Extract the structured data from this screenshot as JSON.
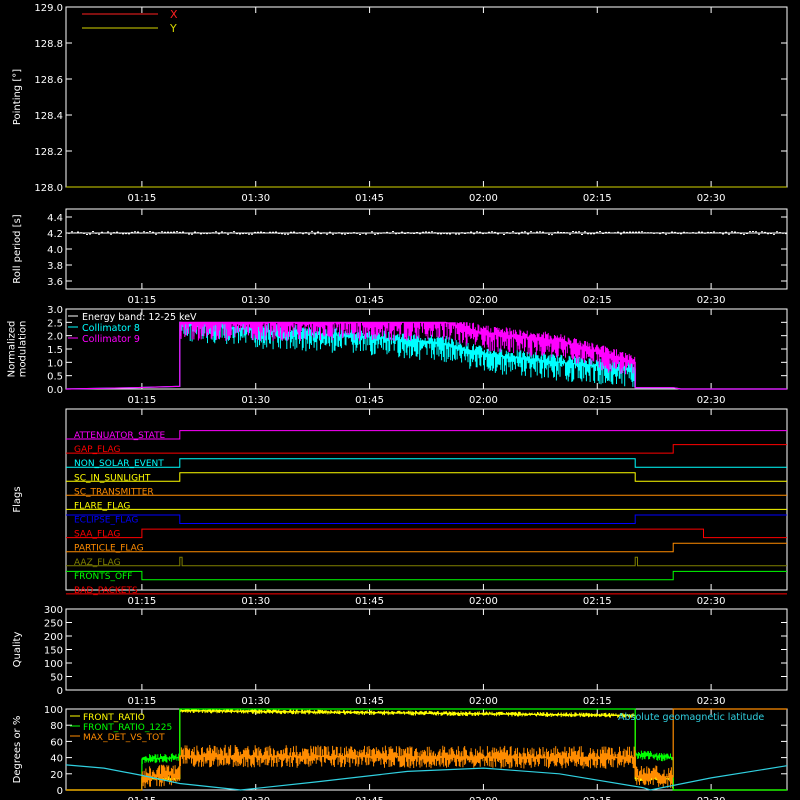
{
  "time_axis": {
    "start": "01:05",
    "end": "02:40",
    "ticks": [
      "01:15",
      "01:30",
      "01:45",
      "02:00",
      "02:15",
      "02:30"
    ]
  },
  "colors": {
    "axes": "#ffffff",
    "x": "#ff2020",
    "y": "#d4d400",
    "white": "#ffffff",
    "cyan": "#00ffff",
    "magenta": "#ff00ff",
    "orange": "#ff8c00",
    "green": "#00ff00",
    "yellow": "#ffff00",
    "blue": "#0000ff",
    "olive": "#808000",
    "red": "#ff0000",
    "geomag": "#30d0e0"
  },
  "chart_data": [
    {
      "id": "pointing",
      "type": "line",
      "ylabel": "Pointing [°]",
      "ylim": [
        128.0,
        129.0
      ],
      "yticks": [
        "128.0",
        "128.2",
        "128.4",
        "128.6",
        "128.8",
        "129.0"
      ],
      "legend": [
        "X",
        "Y"
      ],
      "legend_placement": "top-left",
      "series": [
        {
          "name": "X",
          "color_key": "x",
          "points": [
            [
              "01:05",
              128.0
            ],
            [
              "02:40",
              128.0
            ]
          ]
        },
        {
          "name": "Y",
          "color_key": "y",
          "points": [
            [
              "01:05",
              128.0
            ],
            [
              "02:40",
              128.0
            ]
          ]
        }
      ]
    },
    {
      "id": "roll",
      "type": "line",
      "ylabel": "Roll period [s]",
      "ylim": [
        3.5,
        4.5
      ],
      "yticks": [
        "3.6",
        "3.8",
        "4.0",
        "4.2",
        "4.4"
      ],
      "series": [
        {
          "color_key": "white",
          "points": [
            [
              "01:05",
              4.2
            ],
            [
              "02:40",
              4.2
            ]
          ]
        }
      ]
    },
    {
      "id": "modulation",
      "type": "line",
      "ylabel": [
        "Normalized",
        "modulation"
      ],
      "ylim": [
        0.0,
        3.0
      ],
      "yticks": [
        "0.0",
        "0.5",
        "1.0",
        "1.5",
        "2.0",
        "2.5",
        "3.0"
      ],
      "legend": [
        "Energy band: 12-25 keV",
        "Collimator 8",
        "Collimator 9"
      ],
      "legend_placement": "top-left",
      "series": [
        {
          "name": "Collimator 8",
          "color_key": "cyan",
          "points": [
            [
              "01:05",
              0.0
            ],
            [
              "01:14",
              0.05
            ],
            [
              "01:20",
              0.1
            ],
            [
              "01:20",
              2.5
            ],
            [
              "01:30",
              2.2
            ],
            [
              "01:45",
              1.95
            ],
            [
              "01:55",
              1.7
            ],
            [
              "02:00",
              1.3
            ],
            [
              "02:10",
              1.0
            ],
            [
              "02:20",
              0.75
            ],
            [
              "02:20",
              0.05
            ],
            [
              "02:25",
              0.05
            ],
            [
              "02:26",
              0.0
            ],
            [
              "02:40",
              0.0
            ]
          ]
        },
        {
          "name": "Collimator 9",
          "color_key": "magenta",
          "points": [
            [
              "01:05",
              0.0
            ],
            [
              "01:14",
              0.05
            ],
            [
              "01:20",
              0.1
            ],
            [
              "01:20",
              2.5
            ],
            [
              "01:55",
              2.5
            ],
            [
              "02:00",
              2.1
            ],
            [
              "02:10",
              1.8
            ],
            [
              "02:20",
              1.0
            ],
            [
              "02:20",
              0.05
            ],
            [
              "02:25",
              0.05
            ],
            [
              "02:26",
              0.0
            ],
            [
              "02:40",
              0.0
            ]
          ]
        }
      ]
    },
    {
      "id": "flags",
      "type": "line",
      "ylabel": "Flags",
      "flags": [
        {
          "name": "ATTENUATOR_STATE",
          "color_key": "magenta",
          "steps": [
            [
              "01:05",
              0
            ],
            [
              "01:20",
              1
            ]
          ]
        },
        {
          "name": "GAP_FLAG",
          "color_key": "red",
          "steps": [
            [
              "01:05",
              0
            ],
            [
              "02:25",
              1
            ]
          ]
        },
        {
          "name": "NON_SOLAR_EVENT",
          "color_key": "cyan",
          "steps": [
            [
              "01:05",
              0
            ],
            [
              "01:20",
              1
            ],
            [
              "02:20",
              0
            ]
          ]
        },
        {
          "name": "SC_IN_SUNLIGHT",
          "color_key": "yellow",
          "steps": [
            [
              "01:05",
              0
            ],
            [
              "01:20",
              1
            ],
            [
              "02:20",
              0
            ]
          ]
        },
        {
          "name": "SC_TRANSMITTER",
          "color_key": "orange",
          "steps": [
            [
              "01:05",
              0
            ]
          ]
        },
        {
          "name": "FLARE_FLAG",
          "color_key": "yellow",
          "steps": [
            [
              "01:05",
              0
            ]
          ]
        },
        {
          "name": "ECLIPSE_FLAG",
          "color_key": "blue",
          "steps": [
            [
              "01:05",
              1
            ],
            [
              "01:20",
              0
            ],
            [
              "02:20",
              1
            ]
          ]
        },
        {
          "name": "SAA_FLAG",
          "color_key": "red",
          "steps": [
            [
              "01:05",
              0
            ],
            [
              "01:15",
              1
            ],
            [
              "02:29",
              0
            ]
          ]
        },
        {
          "name": "PARTICLE_FLAG",
          "color_key": "orange",
          "steps": [
            [
              "01:05",
              0
            ],
            [
              "02:25",
              1
            ]
          ]
        },
        {
          "name": "AAZ_FLAG",
          "color_key": "olive",
          "steps": [
            [
              "01:05",
              0
            ],
            [
              "01:20",
              1
            ],
            [
              "01:20.3",
              0
            ],
            [
              "02:20",
              1
            ],
            [
              "02:20.3",
              0
            ]
          ]
        },
        {
          "name": "FRONTS_OFF",
          "color_key": "green",
          "steps": [
            [
              "01:05",
              1
            ],
            [
              "01:15",
              0
            ],
            [
              "02:25",
              1
            ]
          ]
        },
        {
          "name": "BAD_PACKETS",
          "color_key": "red",
          "steps": [
            [
              "01:05",
              0
            ]
          ]
        }
      ]
    },
    {
      "id": "quality",
      "type": "line",
      "ylabel": "Quality",
      "ylim": [
        0,
        300
      ],
      "yticks": [
        "0",
        "50",
        "100",
        "150",
        "200",
        "250",
        "300"
      ],
      "series": [
        {
          "color_key": "white",
          "points": [
            [
              "01:05",
              300
            ],
            [
              "02:40",
              300
            ]
          ]
        }
      ]
    },
    {
      "id": "ratios",
      "type": "line",
      "ylabel": "Degrees or %",
      "ylim": [
        0,
        100
      ],
      "yticks": [
        "0",
        "20",
        "40",
        "60",
        "80",
        "100"
      ],
      "legend": [
        "FRONT_RATIO",
        "FRONT_RATIO_1225",
        "MAX_DET_VS_TOT"
      ],
      "annotation": "Absolute geomagnetic latitude",
      "series": [
        {
          "name": "FRONT_RATIO",
          "color_key": "yellow",
          "points": [
            [
              "01:05",
              0
            ],
            [
              "01:15",
              0
            ],
            [
              "01:15",
              14
            ],
            [
              "01:20",
              14
            ],
            [
              "01:20",
              98
            ],
            [
              "02:20",
              92
            ],
            [
              "02:20",
              14
            ],
            [
              "02:25",
              14
            ],
            [
              "02:25",
              0
            ],
            [
              "02:40",
              0
            ]
          ]
        },
        {
          "name": "FRONT_RATIO_1225",
          "color_key": "green",
          "points": [
            [
              "01:05",
              0
            ],
            [
              "01:15",
              0
            ],
            [
              "01:15",
              38
            ],
            [
              "01:20",
              40
            ],
            [
              "01:20",
              100
            ],
            [
              "02:20",
              100
            ],
            [
              "02:20",
              44
            ],
            [
              "02:25",
              40
            ],
            [
              "02:25",
              0
            ],
            [
              "02:40",
              0
            ]
          ]
        },
        {
          "name": "MAX_DET_VS_TOT",
          "color_key": "orange",
          "points": [
            [
              "01:05",
              0
            ],
            [
              "01:15",
              0
            ],
            [
              "01:15",
              16
            ],
            [
              "01:20",
              20
            ],
            [
              "01:20",
              42
            ],
            [
              "02:20",
              40
            ],
            [
              "02:20",
              17
            ],
            [
              "02:25",
              16
            ],
            [
              "02:25",
              100
            ],
            [
              "02:40",
              100
            ]
          ]
        },
        {
          "name": "Absolute geomagnetic latitude",
          "color_key": "geomag",
          "points": [
            [
              "01:05",
              31
            ],
            [
              "01:10",
              27
            ],
            [
              "01:15",
              18
            ],
            [
              "01:20",
              8
            ],
            [
              "01:28",
              0
            ],
            [
              "01:38",
              10
            ],
            [
              "01:50",
              23
            ],
            [
              "02:00",
              27
            ],
            [
              "02:10",
              20
            ],
            [
              "02:21",
              3
            ],
            [
              "02:22",
              0
            ],
            [
              "02:30",
              15
            ],
            [
              "02:40",
              30
            ]
          ]
        }
      ]
    }
  ]
}
